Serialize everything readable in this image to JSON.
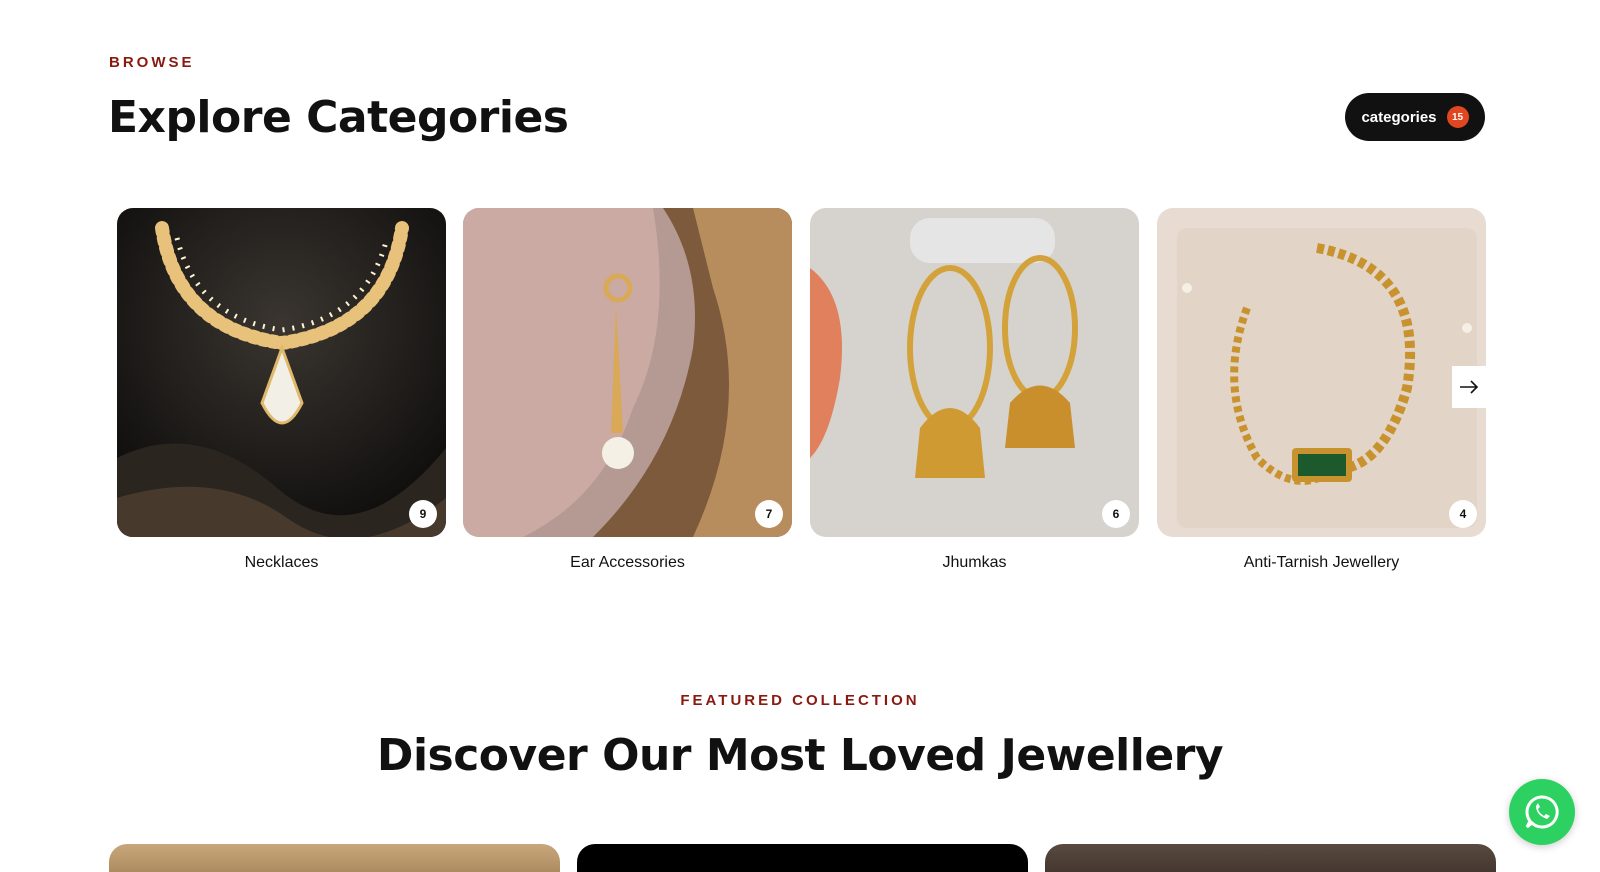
{
  "browse": {
    "eyebrow": "BROWSE",
    "title": "Explore Categories",
    "categories_button": {
      "label": "categories",
      "count": "15"
    }
  },
  "categories": [
    {
      "label": "Necklaces",
      "count": "9",
      "image": "necklace-photo"
    },
    {
      "label": "Ear Accessories",
      "count": "7",
      "image": "pearl-earring-photo"
    },
    {
      "label": "Jhumkas",
      "count": "6",
      "image": "jhumka-photo"
    },
    {
      "label": "Anti-Tarnish Jewellery",
      "count": "4",
      "image": "bracelet-photo"
    }
  ],
  "featured": {
    "eyebrow": "FEATURED COLLECTION",
    "title": "Discover Our Most Loved Jewellery"
  },
  "icons": {
    "next": "arrow-right-icon",
    "whatsapp": "whatsapp-icon"
  },
  "colors": {
    "accent": "#8a1a10",
    "badge": "#e0461f",
    "pill": "#111111",
    "whatsapp": "#2dd161"
  }
}
